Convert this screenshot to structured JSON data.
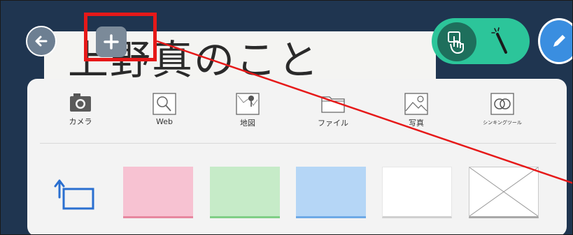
{
  "card": {
    "title": "上野真のこと"
  },
  "toolbar": {
    "back_icon": "arrow-left-icon",
    "add_icon": "plus-icon",
    "toggle_icons": [
      "touch-hand-icon",
      "magic-wand-icon"
    ],
    "edit_icon": "pencil-icon"
  },
  "menu": {
    "tools": [
      {
        "label": "カメラ",
        "icon": "camera-icon"
      },
      {
        "label": "Web",
        "icon": "web-search-icon"
      },
      {
        "label": "地図",
        "icon": "map-icon"
      },
      {
        "label": "ファイル",
        "icon": "folder-icon"
      },
      {
        "label": "写真",
        "icon": "photo-icon"
      },
      {
        "label": "シンキングツール",
        "icon": "thinking-tool-icon"
      }
    ],
    "card_colors": [
      {
        "name": "pink",
        "color": "#f7c2d2"
      },
      {
        "name": "green",
        "color": "#c6ebc8"
      },
      {
        "name": "blue",
        "color": "#b5d6f6"
      },
      {
        "name": "white",
        "color": "#ffffff"
      },
      {
        "name": "none",
        "color": "#ffffff"
      }
    ]
  },
  "colors": {
    "background": "#1f3550",
    "highlight": "#e61919",
    "toggle": "#2cc59a",
    "edit_button": "#3a8ee0"
  }
}
